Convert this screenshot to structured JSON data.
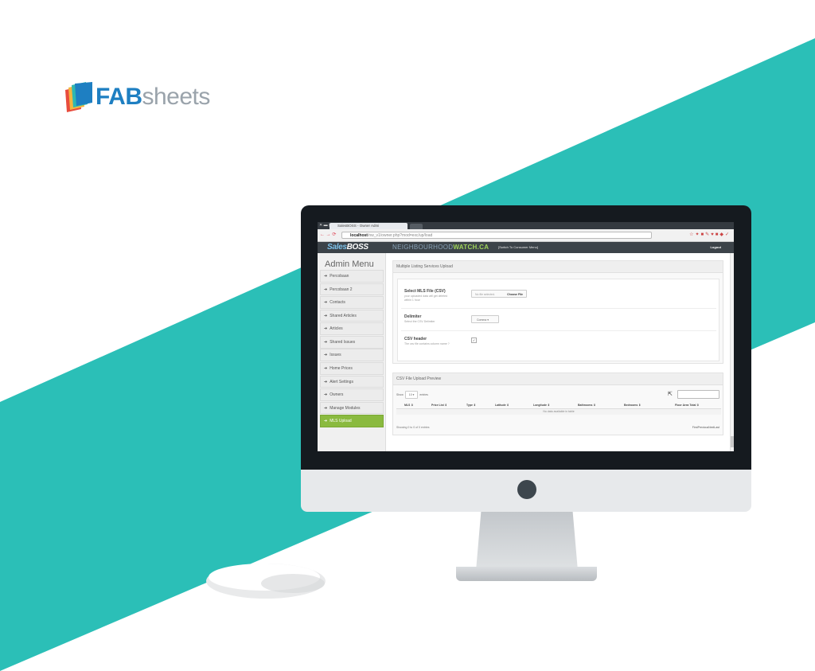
{
  "colors": {
    "teal": "#2bbfb7",
    "brand_blue": "#1e7fc2",
    "logo_gray": "#9aa3ab",
    "active_menu": "#8aba3f"
  },
  "logo": {
    "part_a": "FAB",
    "part_b": "sheets"
  },
  "browser": {
    "tab_title": "SalesBOSS - Owner Admi",
    "url_host": "localhost",
    "url_path": "/nw_v1/owner.php?mod=exc/up/load"
  },
  "app": {
    "brand_a": "Sales",
    "brand_b": "BOSS",
    "partner_a": "NEIGHBOURHOOD",
    "partner_b": "WATCH.CA",
    "switch_link": "[Switch To Consumer Menu]",
    "logout": "Logout"
  },
  "sidebar": {
    "title": "Admin Menu",
    "items": [
      {
        "label": "Percobaan"
      },
      {
        "label": "Percobaan 2"
      },
      {
        "label": "Contacts"
      },
      {
        "label": "Shared Articles"
      },
      {
        "label": "Articles"
      },
      {
        "label": "Shared Issues"
      },
      {
        "label": "Issues"
      },
      {
        "label": "Home Prices"
      },
      {
        "label": "Alert Settings"
      },
      {
        "label": "Owners"
      },
      {
        "label": "Manage Modules"
      },
      {
        "label": "MLS Upload"
      }
    ],
    "active_index": 11
  },
  "upload_panel": {
    "title": "Multiple Listing Services Upload",
    "file_label": "Select MLS File (CSV)",
    "file_help": "your uploaded data will get deleted within 1 hour",
    "file_status": "No file selected.",
    "choose_file": "Choose File",
    "delimiter_label": "Delimiter",
    "delimiter_help": "Select the CSV Delimiter",
    "delimiter_value": "Comma",
    "header_label": "CSV header",
    "header_help": "The csv file contains column name ?",
    "header_checked": true
  },
  "preview_panel": {
    "title": "CSV File Upload Preview",
    "show_prefix": "Show",
    "show_value": "10",
    "show_suffix": "entries",
    "search_label": "Search:",
    "columns": [
      "MLS",
      "Price List",
      "Type",
      "Latitude",
      "Longitude",
      "Bathrooms",
      "Bedrooms",
      "Floor Area Total"
    ],
    "empty_text": "No data available in table",
    "info": "Showing 0 to 0 of 0 entries",
    "pager": "FirstPreviousNextLast"
  }
}
